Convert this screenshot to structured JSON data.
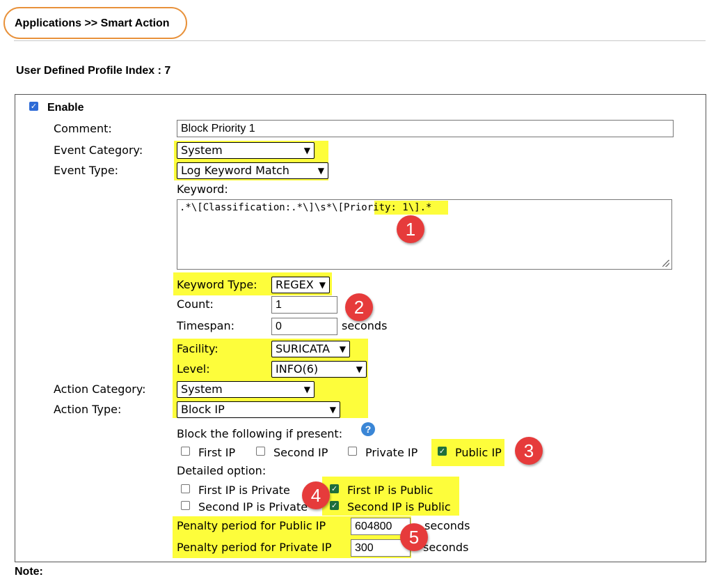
{
  "header": {
    "breadcrumb": "Applications >> Smart Action"
  },
  "profile": {
    "index_label": "User Defined Profile Index : 7"
  },
  "form": {
    "enable_label": "Enable",
    "comment_label": "Comment:",
    "comment_value": "Block Priority 1",
    "event_category_label": "Event Category:",
    "event_category_value": "System",
    "event_type_label": "Event Type:",
    "event_type_value": "Log Keyword Match",
    "keyword_label": "Keyword:",
    "keyword_prefix": ".*\\[Classification:.*\\]\\s*\\[",
    "keyword_highlight": "Priority: 1",
    "keyword_suffix": "\\].*",
    "keyword_type_label": "Keyword Type:",
    "keyword_type_value": "REGEX",
    "count_label": "Count:",
    "count_value": "1",
    "timespan_label": "Timespan:",
    "timespan_value": "0",
    "seconds": "seconds",
    "facility_label": "Facility:",
    "facility_value": "SURICATA",
    "level_label": "Level:",
    "level_value": "INFO(6)",
    "action_category_label": "Action Category:",
    "action_category_value": "System",
    "action_type_label": "Action Type:",
    "action_type_value": "Block IP",
    "block_label": "Block the following if present:",
    "first_ip": "First IP",
    "second_ip": "Second IP",
    "private_ip": "Private IP",
    "public_ip": "Public IP",
    "detailed_label": "Detailed option:",
    "first_ip_private": "First IP is Private",
    "first_ip_public": "First IP is Public",
    "second_ip_private": "Second IP is Private",
    "second_ip_public": "Second IP is Public",
    "penalty_public_label": "Penalty period for Public IP",
    "penalty_public_value": "604800",
    "penalty_private_label": "Penalty period for Private IP",
    "penalty_private_value": "300"
  },
  "footer": {
    "note_label": "Note:"
  },
  "badges": [
    "1",
    "2",
    "3",
    "4",
    "5"
  ],
  "icons": {
    "help": "question-mark-circle-icon",
    "dropdown": "chevron-down-icon"
  },
  "colors": {
    "highlight": "#fdfd3b",
    "badge": "#e63b3b",
    "header_border": "#e8913a",
    "checkbox_checked": "#1f6f3b"
  }
}
